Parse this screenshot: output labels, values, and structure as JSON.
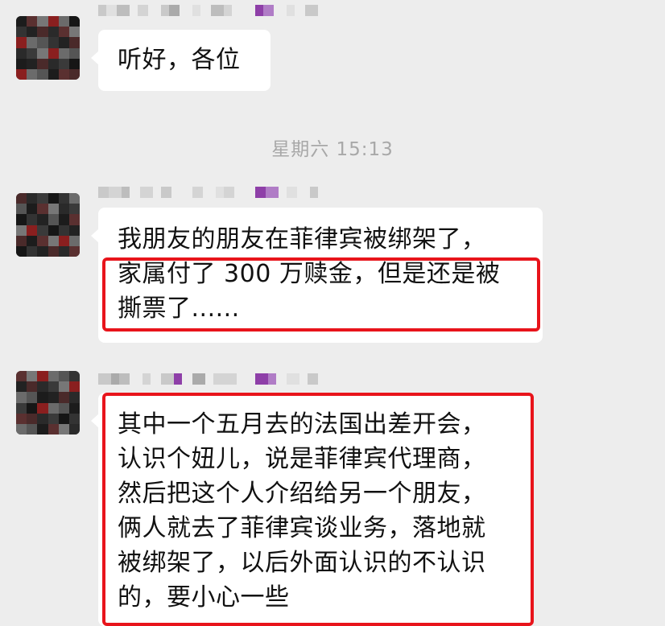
{
  "messages": [
    {
      "id": "msg1",
      "text": "听好，各位"
    },
    {
      "id": "msg2",
      "line1": "我朋友的朋友在菲律宾被绑架了，",
      "highlighted": "家属付了 300 万赎金，但是还是被\n撕票了......"
    },
    {
      "id": "msg3",
      "text": "其中一个五月去的法国出差开会，\n认识个妞儿，说是菲律宾代理商，\n然后把这个人介绍给另一个朋友，\n俩人就去了菲律宾谈业务，落地就\n被绑架了，以后外面认识的不认识\n的，要小心一些"
    }
  ],
  "timestamp": "星期六 15:13",
  "colors": {
    "background": "#ededed",
    "bubble": "#ffffff",
    "highlight_border": "#e8141b",
    "timestamp_text": "#a8a8a8",
    "mosaic_purple": "#8e3fa8"
  },
  "icons": {
    "avatar": "pixelated-avatar",
    "nickname": "pixelated-nickname"
  }
}
